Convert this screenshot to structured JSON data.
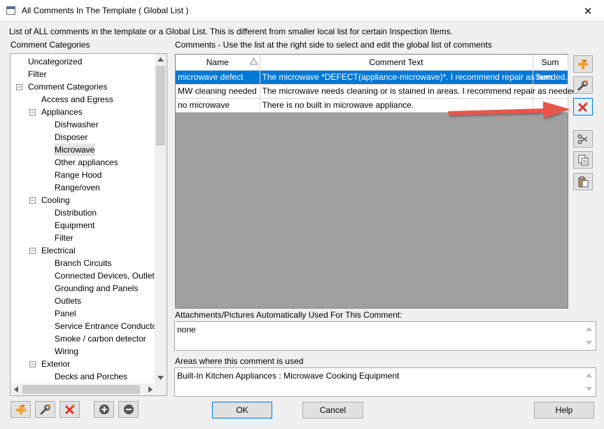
{
  "window": {
    "title": "All Comments In The Template ( Global List )"
  },
  "description": "List of ALL comments in the template or a Global List.  This is different from smaller local list for certain Inspection Items.",
  "tree": {
    "label": "Comment Categories",
    "items": [
      {
        "label": "Uncategorized",
        "level": 0,
        "expander": ""
      },
      {
        "label": "Filter",
        "level": 0,
        "expander": ""
      },
      {
        "label": "Comment Categories",
        "level": 0,
        "expander": "−"
      },
      {
        "label": "Access and Egress",
        "level": 1,
        "expander": ""
      },
      {
        "label": "Appliances",
        "level": 1,
        "expander": "−"
      },
      {
        "label": "Dishwasher",
        "level": 2,
        "expander": ""
      },
      {
        "label": "Disposer",
        "level": 2,
        "expander": ""
      },
      {
        "label": "Microwave",
        "level": 2,
        "expander": "",
        "selected": true
      },
      {
        "label": "Other appliances",
        "level": 2,
        "expander": ""
      },
      {
        "label": "Range Hood",
        "level": 2,
        "expander": ""
      },
      {
        "label": "Range/oven",
        "level": 2,
        "expander": ""
      },
      {
        "label": "Cooling",
        "level": 1,
        "expander": "−"
      },
      {
        "label": "Distribution",
        "level": 2,
        "expander": ""
      },
      {
        "label": "Equipment",
        "level": 2,
        "expander": ""
      },
      {
        "label": "Filter",
        "level": 2,
        "expander": ""
      },
      {
        "label": "Electrical",
        "level": 1,
        "expander": "−"
      },
      {
        "label": "Branch Circuits",
        "level": 2,
        "expander": ""
      },
      {
        "label": "Connected Devices, Outlets",
        "level": 2,
        "expander": ""
      },
      {
        "label": "Grounding and Panels",
        "level": 2,
        "expander": ""
      },
      {
        "label": "Outlets",
        "level": 2,
        "expander": ""
      },
      {
        "label": "Panel",
        "level": 2,
        "expander": ""
      },
      {
        "label": "Service Entrance Conductors",
        "level": 2,
        "expander": ""
      },
      {
        "label": "Smoke / carbon detector",
        "level": 2,
        "expander": ""
      },
      {
        "label": "Wiring",
        "level": 2,
        "expander": ""
      },
      {
        "label": "Exterior",
        "level": 1,
        "expander": "−"
      },
      {
        "label": "Decks and Porches",
        "level": 2,
        "expander": ""
      }
    ]
  },
  "comments": {
    "label": "Comments - Use the list at the right side to select and edit the global list of comments",
    "columns": {
      "name": "Name",
      "text": "Comment Text",
      "sum": "Sum"
    },
    "rows": [
      {
        "name": "microwave defect",
        "text": "The microwave *DEFECT(appliance-microwave)*. I recommend repair as needed.",
        "sum": "Sum",
        "selected": true
      },
      {
        "name": "MW cleaning needed",
        "text": "The microwave needs cleaning or is stained in areas. I recommend repair as needed.",
        "sum": ""
      },
      {
        "name": "no microwave",
        "text": "There is no built in microwave appliance.",
        "sum": ""
      }
    ]
  },
  "attachments": {
    "label": "Attachments/Pictures Automatically Used For This Comment:",
    "value": "none"
  },
  "areas": {
    "label": "Areas where this comment is used",
    "value": "Built-In Kitchen Appliances : Microwave Cooking Equipment"
  },
  "buttons": {
    "ok": "OK",
    "cancel": "Cancel",
    "help": "Help"
  },
  "icons": {
    "add": "add-comment-icon",
    "edit": "edit-comment-icon",
    "delete": "delete-comment-icon",
    "cut": "cut-icon",
    "copy": "copy-icon",
    "paste": "paste-icon",
    "plus": "expand-all-icon",
    "minus": "collapse-all-icon"
  },
  "colors": {
    "selection": "#0078d7",
    "annotation_arrow": "#e8544a",
    "delete_red": "#d9342b",
    "add_orange": "#f0a030"
  }
}
